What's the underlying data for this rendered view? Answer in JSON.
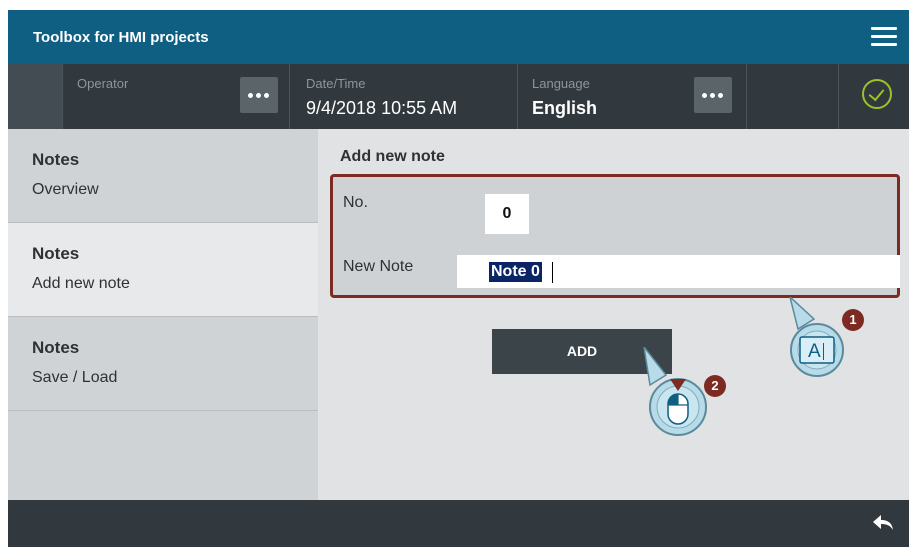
{
  "window": {
    "title": "Toolbox for HMI projects"
  },
  "status": {
    "operator_label": "Operator",
    "datetime_label": "Date/Time",
    "datetime_value": "9/4/2018 10:55 AM",
    "language_label": "Language",
    "language_value": "English",
    "status_icon": "check-circle-icon",
    "ok_color": "#9cc227"
  },
  "sidebar": {
    "items": [
      {
        "title": "Notes",
        "subtitle": "Overview"
      },
      {
        "title": "Notes",
        "subtitle": "Add new note"
      },
      {
        "title": "Notes",
        "subtitle": "Save / Load"
      }
    ],
    "active_index": 1
  },
  "main": {
    "section_title": "Add new note",
    "number_label": "No.",
    "number_value": "0",
    "note_label": "New Note",
    "note_value": "Note 0",
    "add_label": "ADD"
  },
  "callouts": [
    {
      "number": "1",
      "icon": "text-input-icon",
      "glyph": "A"
    },
    {
      "number": "2",
      "icon": "mouse-click-icon"
    }
  ],
  "colors": {
    "titlebar": "#0f5f83",
    "statusbar": "#31393e",
    "highlight": "#7c2a22",
    "selection": "#0a2466"
  }
}
